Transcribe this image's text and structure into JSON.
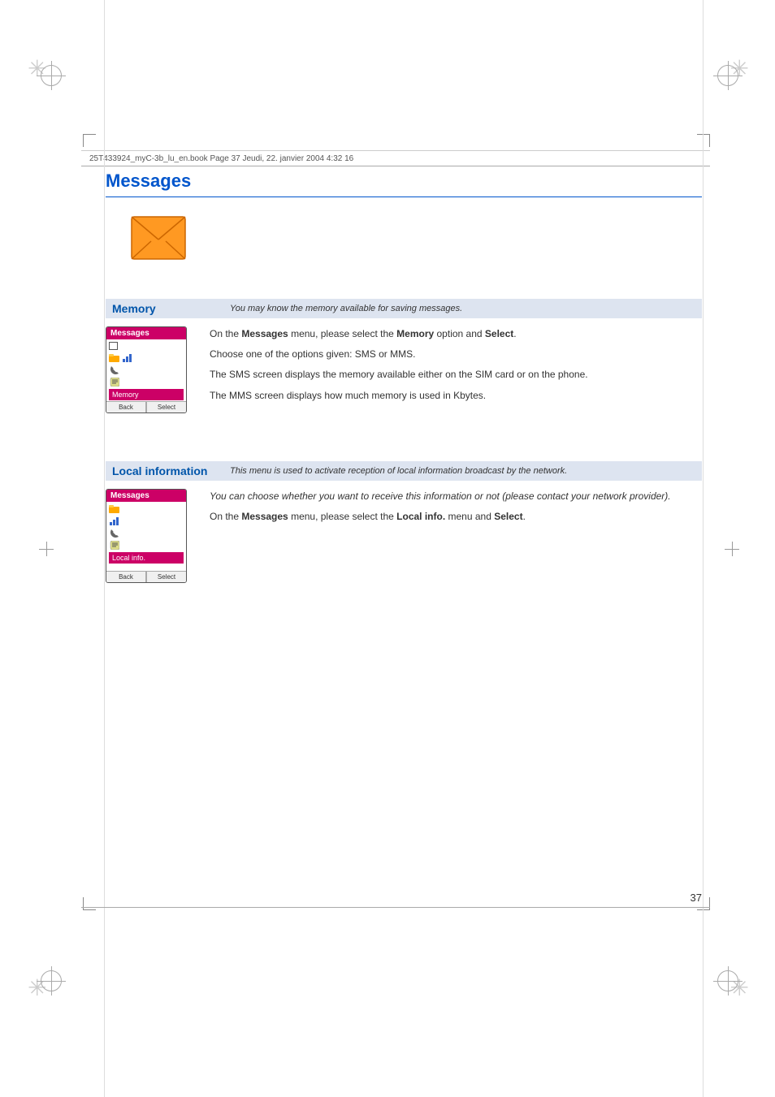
{
  "page": {
    "number": "37",
    "file_info": "25T433924_myC-3b_lu_en.book  Page 37  Jeudi, 22. janvier 2004  4:32 16"
  },
  "title": "Messages",
  "sections": {
    "memory": {
      "title": "Memory",
      "subtitle": "You may know the memory available for saving messages.",
      "phone": {
        "screen_title": "Messages",
        "menu_items": [
          {
            "label": "",
            "icon": "sms-icon",
            "type": "checkbox"
          },
          {
            "label": "",
            "icon": "folder-icon"
          },
          {
            "label": "",
            "icon": "chart-icon"
          },
          {
            "label": "",
            "icon": "phone-icon"
          },
          {
            "label": "Memory",
            "selected": true
          }
        ],
        "buttons": [
          {
            "label": "Back"
          },
          {
            "label": "Select"
          }
        ]
      },
      "paragraphs": [
        {
          "text": "On the Messages menu, please select the Memory option and Select.",
          "bold_words": [
            "Messages",
            "Memory",
            "Select"
          ]
        },
        {
          "text": "Choose one of the options given: SMS or MMS."
        },
        {
          "text": "The SMS screen displays the memory available either on the SIM card or on the phone."
        },
        {
          "text": "The MMS screen displays how much memory is used in Kbytes."
        }
      ]
    },
    "local_information": {
      "title": "Local information",
      "subtitle": "This menu is used to activate reception of local information broadcast by the network.",
      "phone": {
        "screen_title": "Messages",
        "menu_items": [
          {
            "label": "",
            "icon": "folder-icon"
          },
          {
            "label": "",
            "icon": "chart-icon"
          },
          {
            "label": "",
            "icon": "phone-icon"
          },
          {
            "label": "",
            "icon": "scroll-icon"
          },
          {
            "label": "Local info.",
            "selected": true
          }
        ],
        "buttons": [
          {
            "label": "Back"
          },
          {
            "label": "Select"
          }
        ]
      },
      "paragraphs": [
        {
          "text": "You can choose whether you want to receive this information or not (please contact your network provider).",
          "italic": true
        },
        {
          "text": "On the Messages menu, please select the Local info. menu and Select.",
          "bold_words": [
            "Messages",
            "Local info.",
            "Select"
          ]
        }
      ]
    }
  },
  "registration_marks": {
    "crosshairs": [
      "top-left",
      "top-right",
      "bottom-left",
      "bottom-right"
    ],
    "circles": [
      "top-left",
      "top-right",
      "bottom-left",
      "bottom-right"
    ]
  }
}
